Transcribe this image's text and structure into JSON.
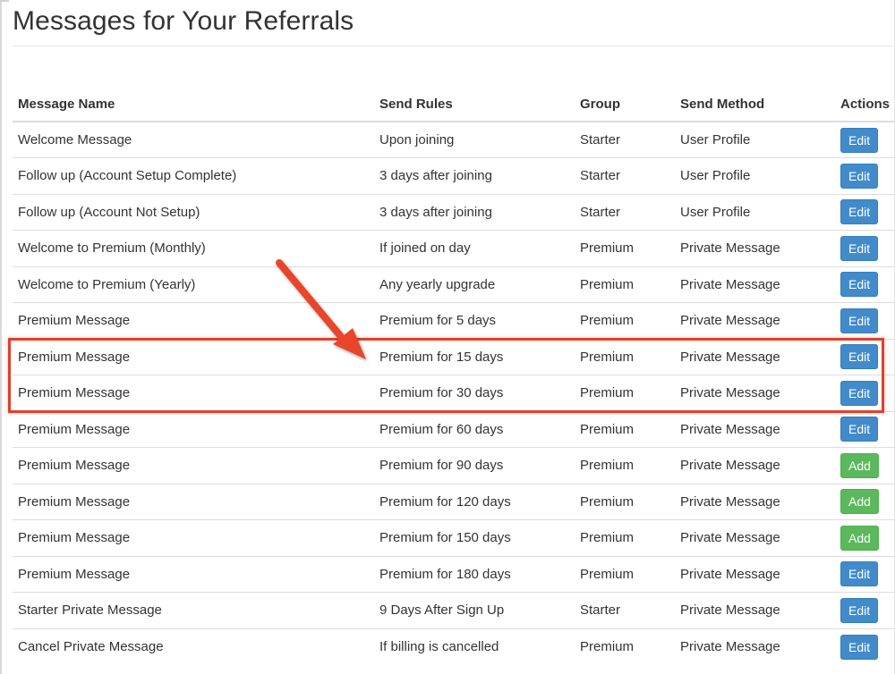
{
  "page": {
    "title": "Messages for Your Referrals"
  },
  "colors": {
    "edit_button": "#428bca",
    "add_button": "#5cb85c",
    "highlight": "#e0402a",
    "text": "#333333"
  },
  "table": {
    "headers": {
      "name": "Message Name",
      "rules": "Send Rules",
      "group": "Group",
      "method": "Send Method",
      "actions": "Actions"
    },
    "rows": [
      {
        "name": "Welcome Message",
        "rules": "Upon joining",
        "group": "Starter",
        "method": "User Profile",
        "action": "Edit",
        "action_type": "edit"
      },
      {
        "name": "Follow up (Account Setup Complete)",
        "rules": "3 days after joining",
        "group": "Starter",
        "method": "User Profile",
        "action": "Edit",
        "action_type": "edit"
      },
      {
        "name": "Follow up (Account Not Setup)",
        "rules": "3 days after joining",
        "group": "Starter",
        "method": "User Profile",
        "action": "Edit",
        "action_type": "edit"
      },
      {
        "name": "Welcome to Premium (Monthly)",
        "rules": "If joined on day",
        "group": "Premium",
        "method": "Private Message",
        "action": "Edit",
        "action_type": "edit"
      },
      {
        "name": "Welcome to Premium (Yearly)",
        "rules": "Any yearly upgrade",
        "group": "Premium",
        "method": "Private Message",
        "action": "Edit",
        "action_type": "edit"
      },
      {
        "name": "Premium Message",
        "rules": "Premium for 5 days",
        "group": "Premium",
        "method": "Private Message",
        "action": "Edit",
        "action_type": "edit"
      },
      {
        "name": "Premium Message",
        "rules": "Premium for 15 days",
        "group": "Premium",
        "method": "Private Message",
        "action": "Edit",
        "action_type": "edit"
      },
      {
        "name": "Premium Message",
        "rules": "Premium for 30 days",
        "group": "Premium",
        "method": "Private Message",
        "action": "Edit",
        "action_type": "edit"
      },
      {
        "name": "Premium Message",
        "rules": "Premium for 60 days",
        "group": "Premium",
        "method": "Private Message",
        "action": "Edit",
        "action_type": "edit"
      },
      {
        "name": "Premium Message",
        "rules": "Premium for 90 days",
        "group": "Premium",
        "method": "Private Message",
        "action": "Add",
        "action_type": "add"
      },
      {
        "name": "Premium Message",
        "rules": "Premium for 120 days",
        "group": "Premium",
        "method": "Private Message",
        "action": "Add",
        "action_type": "add"
      },
      {
        "name": "Premium Message",
        "rules": "Premium for 150 days",
        "group": "Premium",
        "method": "Private Message",
        "action": "Add",
        "action_type": "add"
      },
      {
        "name": "Premium Message",
        "rules": "Premium for 180 days",
        "group": "Premium",
        "method": "Private Message",
        "action": "Edit",
        "action_type": "edit"
      },
      {
        "name": "Starter Private Message",
        "rules": "9 Days After Sign Up",
        "group": "Starter",
        "method": "Private Message",
        "action": "Edit",
        "action_type": "edit"
      },
      {
        "name": "Cancel Private Message",
        "rules": "If billing is cancelled",
        "group": "Premium",
        "method": "Private Message",
        "action": "Edit",
        "action_type": "edit"
      }
    ]
  },
  "annotation": {
    "arrow_icon": "red-arrow-icon",
    "highlight_icon": "highlight-box"
  }
}
